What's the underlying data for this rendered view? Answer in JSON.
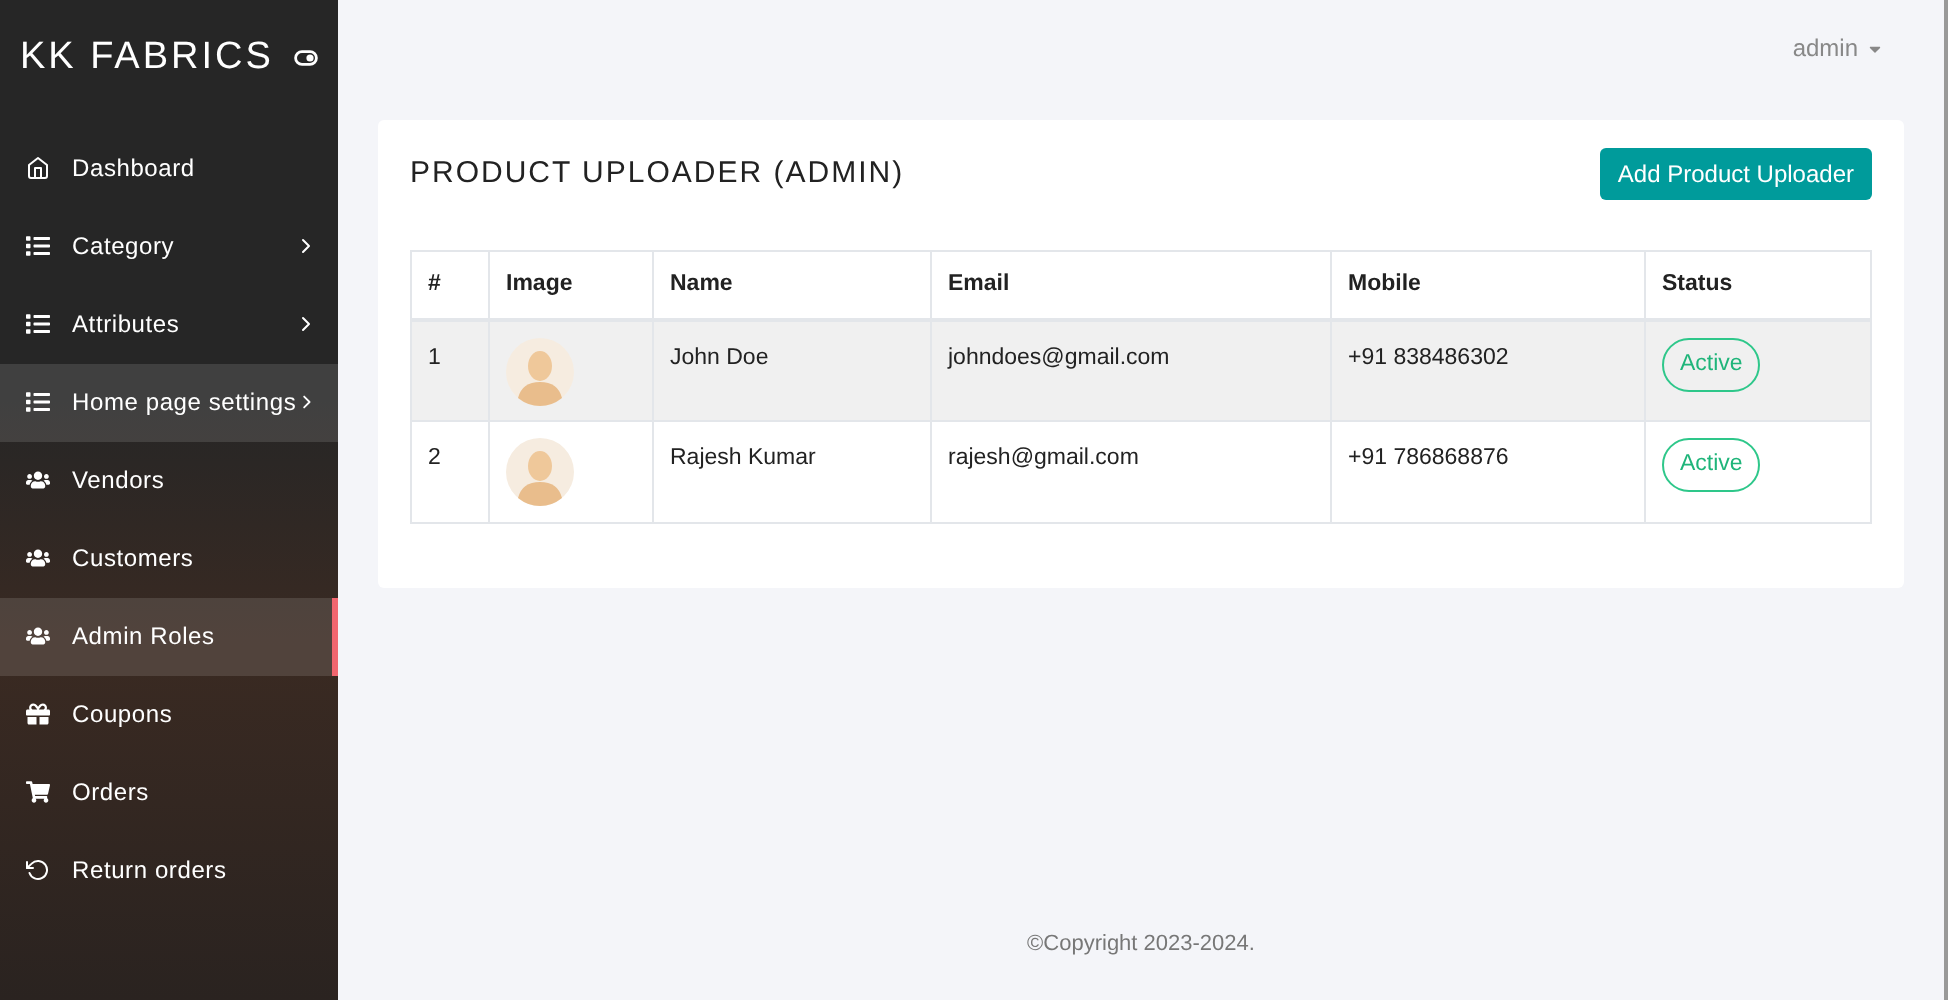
{
  "sidebar": {
    "brand": "KK FABRICS",
    "items": [
      {
        "label": "Dashboard",
        "expandable": false,
        "hovered": false,
        "selected": false
      },
      {
        "label": "Category",
        "expandable": true,
        "hovered": false,
        "selected": false
      },
      {
        "label": "Attributes",
        "expandable": true,
        "hovered": false,
        "selected": false
      },
      {
        "label": "Home page settings",
        "expandable": true,
        "hovered": true,
        "selected": false
      },
      {
        "label": "Vendors",
        "expandable": false,
        "hovered": false,
        "selected": false
      },
      {
        "label": "Customers",
        "expandable": false,
        "hovered": false,
        "selected": false
      },
      {
        "label": "Admin Roles",
        "expandable": false,
        "hovered": false,
        "selected": true
      },
      {
        "label": "Coupons",
        "expandable": false,
        "hovered": false,
        "selected": false
      },
      {
        "label": "Orders",
        "expandable": false,
        "hovered": false,
        "selected": false
      },
      {
        "label": "Return orders",
        "expandable": false,
        "hovered": false,
        "selected": false
      }
    ]
  },
  "header": {
    "user": "admin"
  },
  "card": {
    "title": "PRODUCT UPLOADER (ADMIN)",
    "add_button": "Add Product Uploader",
    "table": {
      "columns": [
        "#",
        "Image",
        "Name",
        "Email",
        "Mobile",
        "Status"
      ],
      "rows": [
        {
          "index": "1",
          "name": "John Doe",
          "email": "johndoes@gmail.com",
          "mobile": "+91 838486302",
          "status": "Active",
          "hovered": true
        },
        {
          "index": "2",
          "name": "Rajesh Kumar",
          "email": "rajesh@gmail.com",
          "mobile": "+91 786868876",
          "status": "Active",
          "hovered": false
        }
      ]
    }
  },
  "footer": "©Copyright 2023-2024."
}
